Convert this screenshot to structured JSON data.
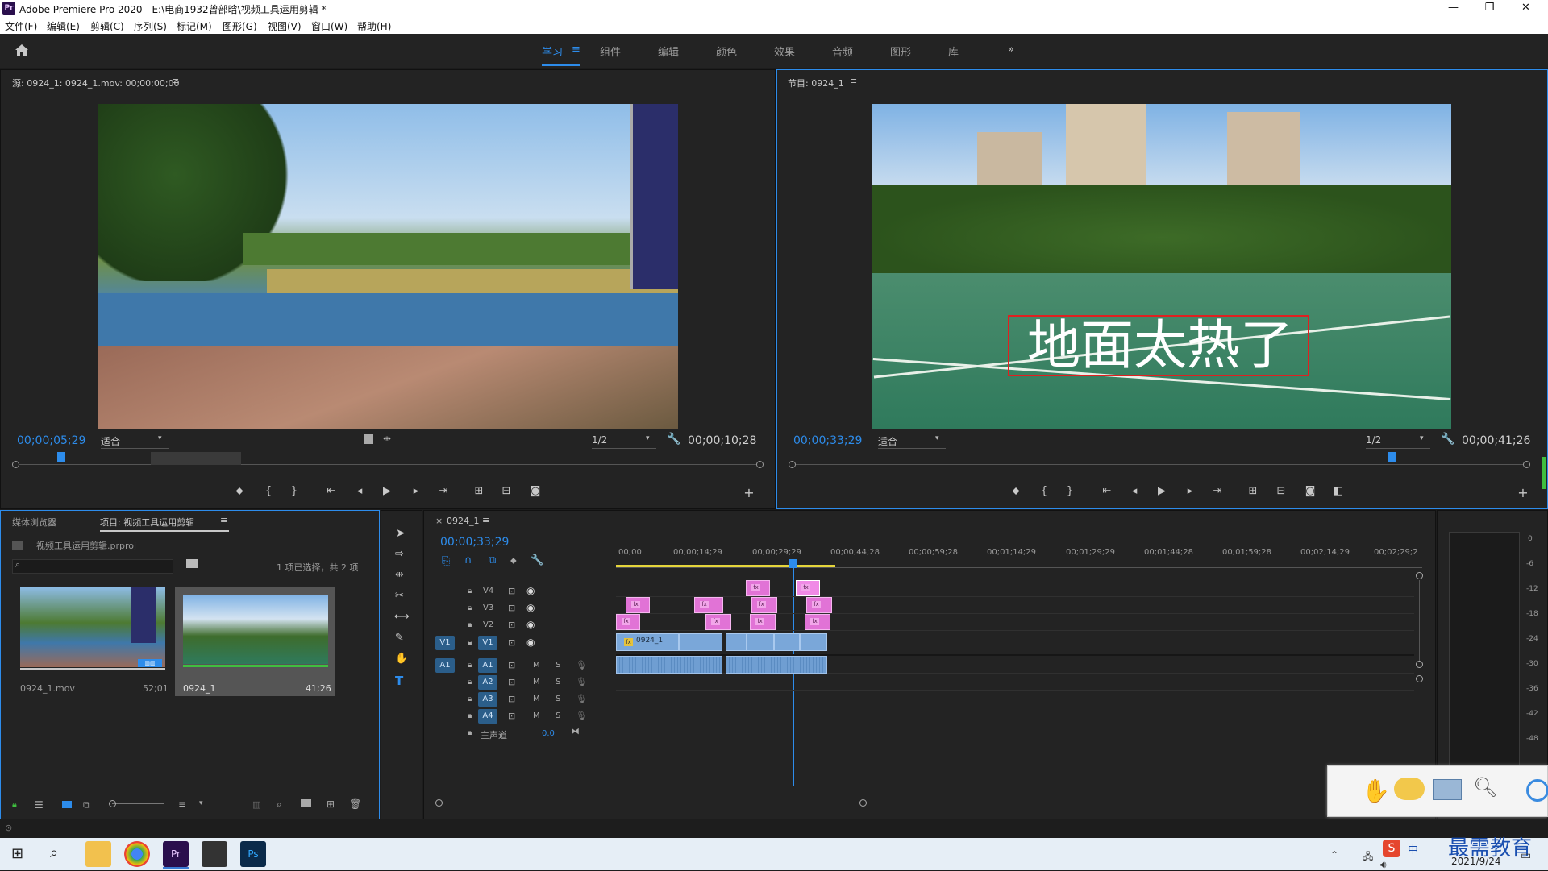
{
  "window": {
    "app_logo": "Pr",
    "title": "Adobe Premiere Pro 2020 - E:\\电商1932曾部晗\\视频工具运用剪辑 *",
    "controls": [
      "—",
      "❐",
      "✕"
    ]
  },
  "menubar": [
    "文件(F)",
    "编辑(E)",
    "剪辑(C)",
    "序列(S)",
    "标记(M)",
    "图形(G)",
    "视图(V)",
    "窗口(W)",
    "帮助(H)"
  ],
  "workspaces": {
    "items": [
      "学习",
      "组件",
      "编辑",
      "颜色",
      "效果",
      "音频",
      "图形",
      "库"
    ],
    "active": "学习",
    "more": "»"
  },
  "source_monitor": {
    "title": "源: 0924_1: 0924_1.mov: 00;00;00;00",
    "timecode": "00;00;05;29",
    "fit": "适合",
    "resolution": "1/2",
    "duration": "00;00;10;28"
  },
  "program_monitor": {
    "title": "节目: 0924_1",
    "timecode": "00;00;33;29",
    "fit": "适合",
    "resolution": "1/2",
    "duration": "00;00;41;26",
    "overlay_text": "地面太热了"
  },
  "project_panel": {
    "tabs": [
      "媒体浏览器",
      "项目: 视频工具运用剪辑"
    ],
    "project_file": "视频工具运用剪辑.prproj",
    "selection_info": "1 项已选择，共 2 项",
    "items": [
      {
        "name": "0924_1.mov",
        "duration": "52;01"
      },
      {
        "name": "0924_1",
        "duration": "41;26"
      }
    ]
  },
  "timeline": {
    "tab": "0924_1",
    "timecode": "00;00;33;29",
    "ruler": [
      "00;00",
      "00;00;14;29",
      "00;00;29;29",
      "00;00;44;28",
      "00;00;59;28",
      "00;01;14;29",
      "00;01;29;29",
      "00;01;44;28",
      "00;01;59;28",
      "00;02;14;29",
      "00;02;29;2"
    ],
    "video_tracks": [
      "V4",
      "V3",
      "V2",
      "V1"
    ],
    "audio_tracks": [
      "A1",
      "A2",
      "A3",
      "A4"
    ],
    "source_patch_video": "V1",
    "source_patch_audio": "A1",
    "master_label": "主声道",
    "master_value": "0.0",
    "clip_label": "0924_1",
    "mute": "M",
    "solo": "S"
  },
  "audio_meter": {
    "scale": [
      "0",
      "-6",
      "-12",
      "-18",
      "-24",
      "-30",
      "-36",
      "-42",
      "-48"
    ]
  },
  "taskbar": {
    "clock_time": "",
    "date": "2021/9/24",
    "ime": "中",
    "watermark": "最需教育"
  },
  "colors": {
    "accent": "#2d8ceb",
    "pink_clip": "#e173d6",
    "video_clip": "#7aa7d9",
    "overlay_box": "#e02020"
  }
}
